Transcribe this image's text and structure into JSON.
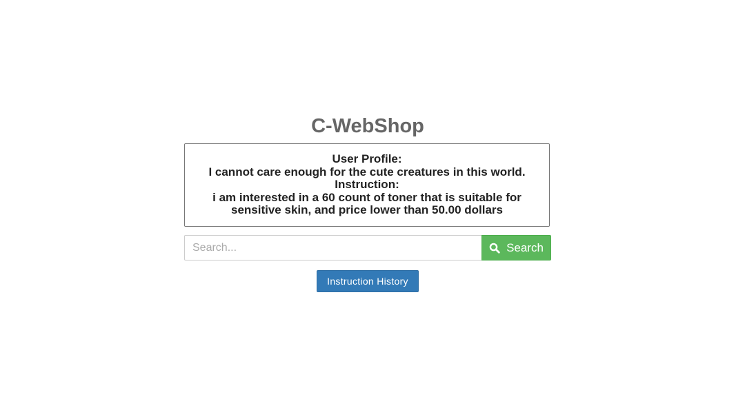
{
  "header": {
    "title": "C-WebShop"
  },
  "profile_box": {
    "profile_heading": "User Profile:",
    "profile_text": "I cannot care enough for the cute creatures in this world.",
    "instruction_heading": "Instruction:",
    "instruction_text": "i am interested in a 60 count of toner that is suitable for sensitive skin, and price lower than 50.00 dollars"
  },
  "search": {
    "placeholder": "Search...",
    "value": "",
    "button_label": "Search",
    "button_icon": "search-icon"
  },
  "history": {
    "button_label": "Instruction History"
  },
  "colors": {
    "search_button": "#5cb85c",
    "history_button": "#337ab7",
    "title": "#666666"
  }
}
